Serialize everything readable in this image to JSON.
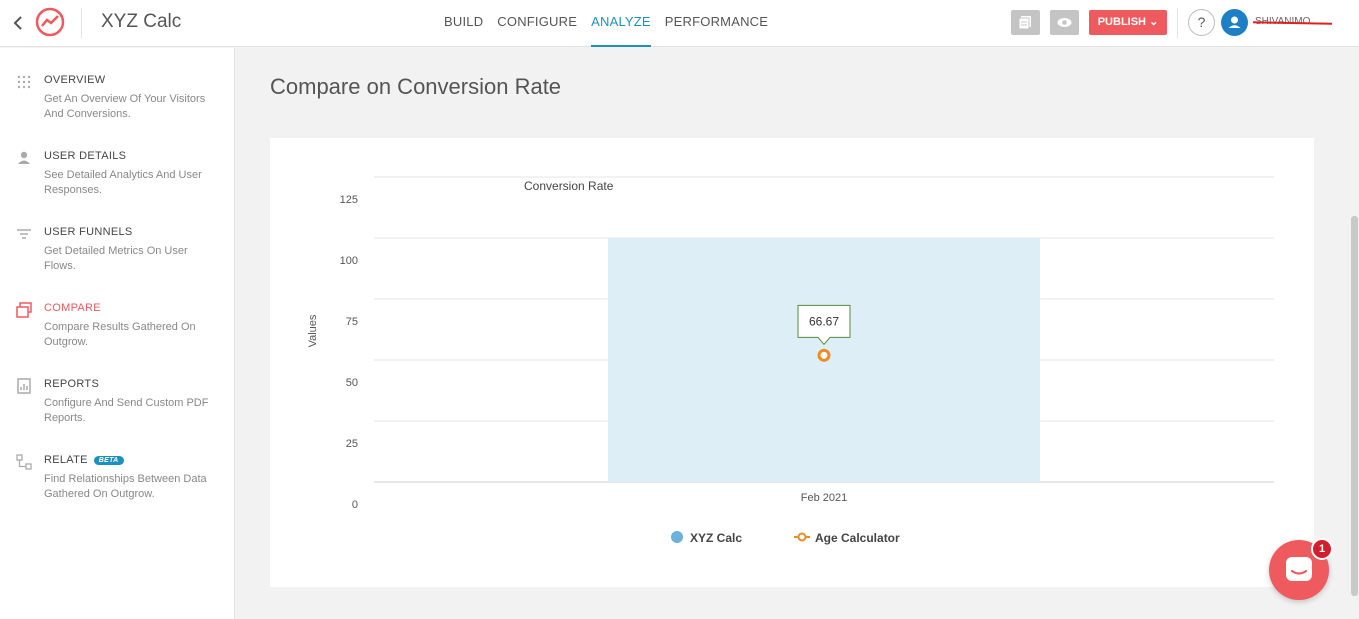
{
  "header": {
    "app_title": "XYZ Calc",
    "tabs": [
      {
        "label": "BUILD",
        "active": false
      },
      {
        "label": "CONFIGURE",
        "active": false
      },
      {
        "label": "ANALYZE",
        "active": true
      },
      {
        "label": "PERFORMANCE",
        "active": false
      }
    ],
    "publish_label": "PUBLISH",
    "help_label": "?",
    "username": "SHIVANIMO...",
    "icons": {
      "back": "chevron-left-icon",
      "logo": "outgrow-logo-icon",
      "pages": "pages-icon",
      "preview": "eye-icon",
      "user": "user-icon"
    }
  },
  "sidebar": {
    "items": [
      {
        "title": "OVERVIEW",
        "desc": "Get An Overview Of Your Visitors And Conversions.",
        "icon": "grid-icon",
        "active": false
      },
      {
        "title": "USER DETAILS",
        "desc": "See Detailed Analytics And User Responses.",
        "icon": "user-icon",
        "active": false
      },
      {
        "title": "USER FUNNELS",
        "desc": "Get Detailed Metrics On User Flows.",
        "icon": "funnel-icon",
        "active": false
      },
      {
        "title": "COMPARE",
        "desc": "Compare Results Gathered On Outgrow.",
        "icon": "compare-icon",
        "active": true
      },
      {
        "title": "REPORTS",
        "desc": "Configure And Send Custom PDF Reports.",
        "icon": "report-icon",
        "active": false
      },
      {
        "title": "RELATE",
        "badge": "BETA",
        "desc": "Find Relationships Between Data Gathered On Outgrow.",
        "icon": "relate-icon",
        "active": false
      }
    ]
  },
  "main": {
    "page_title": "Compare on Conversion Rate"
  },
  "chart_data": {
    "type": "bar",
    "title": "Conversion Rate",
    "ylabel": "Values",
    "xlabel": "",
    "categories": [
      "Feb 2021"
    ],
    "ylim": [
      0,
      125
    ],
    "yticks": [
      0,
      25,
      50,
      75,
      100,
      125
    ],
    "series": [
      {
        "name": "XYZ Calc",
        "kind": "bar",
        "values": [
          100
        ]
      },
      {
        "name": "Age Calculator",
        "kind": "line",
        "values": [
          66.67
        ]
      }
    ],
    "tooltip": "66.67",
    "legend_position": "bottom",
    "grid": true,
    "colors": {
      "bar": "#deeef6",
      "legend_bar": "#6cb0dc",
      "line": "#f08a24",
      "tooltip_border": "#5a8a3a"
    }
  },
  "chat": {
    "badge_count": "1",
    "icon": "chat-icon"
  }
}
